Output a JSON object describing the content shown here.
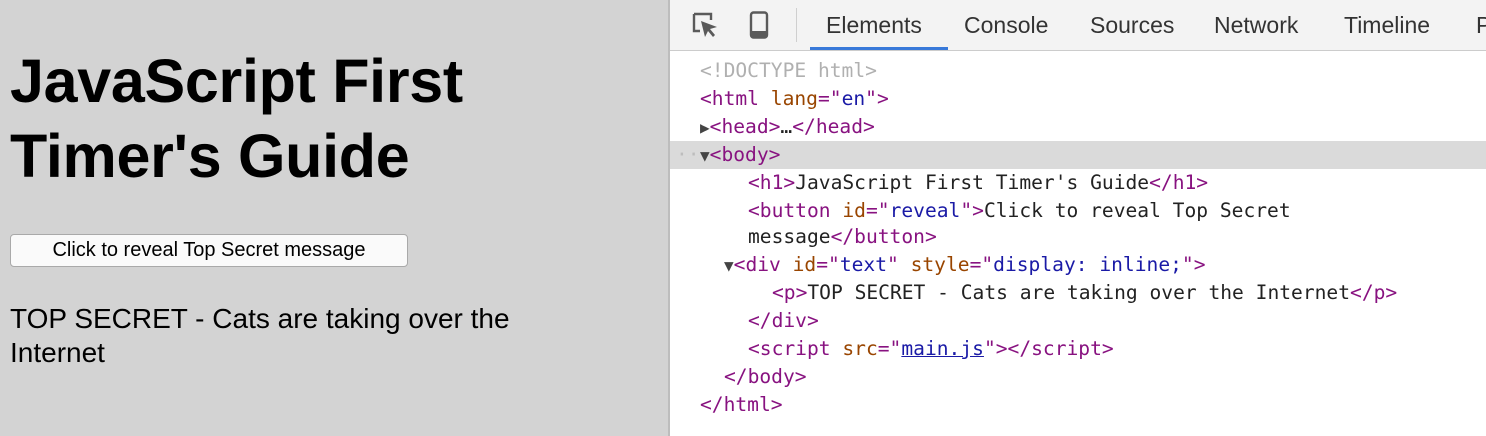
{
  "page": {
    "heading": "JavaScript First Timer's Guide",
    "button_label": "Click to reveal Top Secret message",
    "secret_text": "TOP SECRET - Cats are taking over the Internet"
  },
  "devtools": {
    "tabs": [
      "Elements",
      "Console",
      "Sources",
      "Network",
      "Timeline",
      "P"
    ],
    "active_tab": "Elements",
    "dom": {
      "doctype": "<!DOCTYPE html>",
      "html_open_tag": "html",
      "lang_attr": "lang",
      "lang_value": "en",
      "head_tag": "head",
      "head_collapsed": "…",
      "body_tag": "body",
      "h1_tag": "h1",
      "h1_text": "JavaScript First Timer's Guide",
      "button_tag": "button",
      "button_id_attr": "id",
      "button_id_value": "reveal",
      "button_text_line1": "Click to reveal Top Secret",
      "button_text_line2": "message",
      "div_tag": "div",
      "div_id_attr": "id",
      "div_id_value": "text",
      "div_style_attr": "style",
      "div_style_value": "display: inline;",
      "p_tag": "p",
      "p_text": "TOP SECRET - Cats are taking over the Internet",
      "script_tag": "script",
      "script_src_attr": "src",
      "script_src_value": "main.js"
    }
  },
  "colors": {
    "page_background": "#d3d3d3",
    "tag": "#881280",
    "attr_name": "#994500",
    "attr_value": "#1a1aa6",
    "active_tab_underline": "#3879d9",
    "selected_row": "#dadada"
  },
  "icons": [
    "inspect-element-icon",
    "device-mode-icon"
  ]
}
